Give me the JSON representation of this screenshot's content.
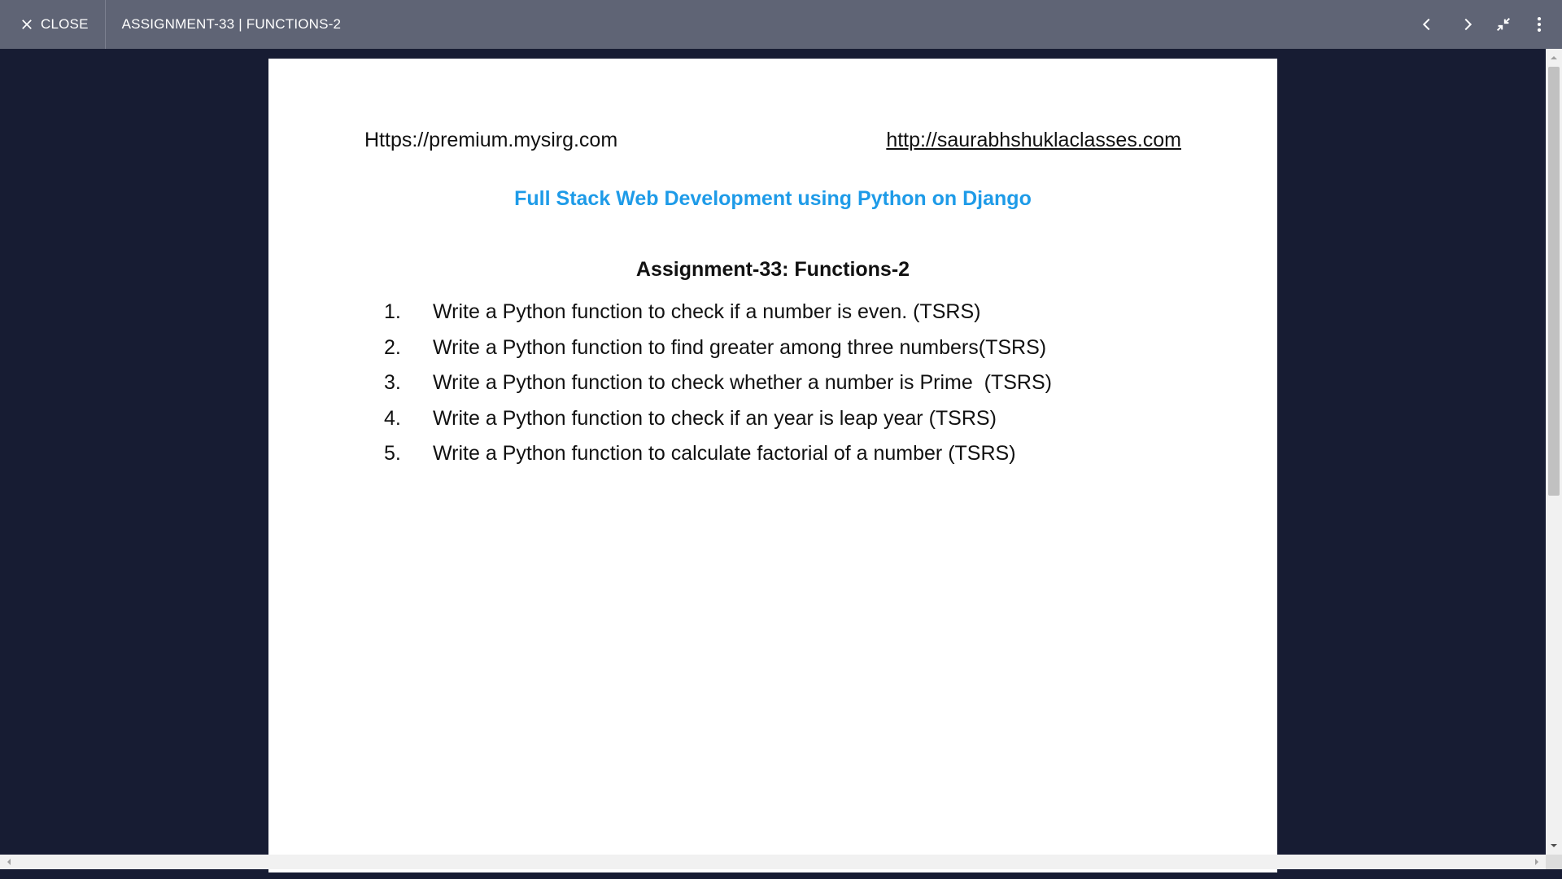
{
  "topbar": {
    "close_label": "CLOSE",
    "document_title": "ASSIGNMENT-33 | FUNCTIONS-2",
    "icons": [
      "close-icon",
      "chevron-left-icon",
      "chevron-right-icon",
      "exit-fullscreen-icon",
      "more-vert-icon"
    ]
  },
  "document": {
    "link_left": "Https://premium.mysirg.com",
    "link_right": "http://saurabhshuklaclasses.com",
    "course_title": "Full Stack Web Development using Python on Django",
    "assignment_title": "Assignment-33: Functions-2",
    "tasks": [
      {
        "num": "1.",
        "text": "Write a Python function to check if a number is even. (TSRS)"
      },
      {
        "num": "2.",
        "text": "Write a Python function to find greater among three numbers(TSRS)"
      },
      {
        "num": "3.",
        "text": "Write a Python function to check whether a number is Prime  (TSRS)"
      },
      {
        "num": "4.",
        "text": "Write a Python function to check if an year is leap year (TSRS)"
      },
      {
        "num": "5.",
        "text": "Write a Python function to calculate factorial of a number (TSRS)"
      }
    ]
  },
  "colors": {
    "topbar_bg": "#5f6475",
    "viewer_bg": "#171c33",
    "course_title": "#1e9be8"
  }
}
